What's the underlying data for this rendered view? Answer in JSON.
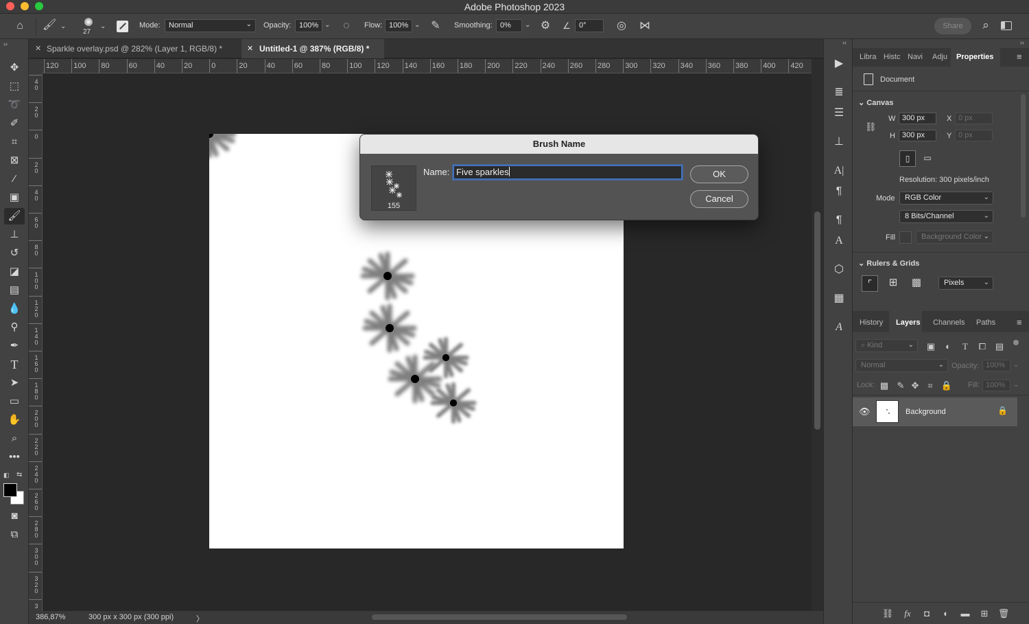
{
  "window": {
    "title": "Adobe Photoshop 2023"
  },
  "options_bar": {
    "brush_size": "27",
    "mode_label": "Mode:",
    "mode_value": "Normal",
    "opacity_label": "Opacity:",
    "opacity_value": "100%",
    "flow_label": "Flow:",
    "flow_value": "100%",
    "smoothing_label": "Smoothing:",
    "smoothing_value": "0%",
    "angle_value": "0°",
    "share_label": "Share"
  },
  "tabs": [
    {
      "label": "Sparkle overlay.psd @ 282% (Layer 1, RGB/8) *",
      "active": false
    },
    {
      "label": "Untitled-1 @ 387% (RGB/8) *",
      "active": true
    }
  ],
  "ruler_h_labels": [
    "120",
    "100",
    "80",
    "60",
    "40",
    "20",
    "0",
    "20",
    "40",
    "60",
    "80",
    "100",
    "120",
    "140",
    "160",
    "180",
    "200",
    "220",
    "240",
    "260",
    "280",
    "300",
    "320",
    "340",
    "360",
    "380",
    "400",
    "420"
  ],
  "ruler_v_labels": [
    "40",
    "20",
    "0",
    "20",
    "40",
    "60",
    "80",
    "100",
    "120",
    "140",
    "160",
    "180",
    "200",
    "220",
    "240",
    "260",
    "280",
    "300",
    "320",
    "3"
  ],
  "status": {
    "zoom": "386,87%",
    "doc_info": "300 px x 300 px (300 ppi)",
    "arrow": "〉"
  },
  "dialog": {
    "title": "Brush Name",
    "preview_size": "155",
    "name_label": "Name:",
    "name_value": "Five sparkles",
    "ok_label": "OK",
    "cancel_label": "Cancel"
  },
  "properties_panel": {
    "tabs": [
      "Libra",
      "Histc",
      "Navi",
      "Adju",
      "Properties"
    ],
    "document_label": "Document",
    "canvas_section": "Canvas",
    "w_label": "W",
    "w_value": "300 px",
    "h_label": "H",
    "h_value": "300 px",
    "x_label": "X",
    "x_value": "0 px",
    "y_label": "Y",
    "y_value": "0 px",
    "resolution": "Resolution: 300 pixels/inch",
    "mode_label": "Mode",
    "mode_value": "RGB Color",
    "bits_value": "8 Bits/Channel",
    "fill_label": "Fill",
    "fill_value": "Background Color",
    "rulers_section": "Rulers & Grids",
    "units_value": "Pixels"
  },
  "layers_panel": {
    "tabs": [
      "History",
      "Layers",
      "Channels",
      "Paths"
    ],
    "kind_placeholder": "Kind",
    "blend_mode": "Normal",
    "opacity_label": "Opacity:",
    "opacity_value": "100%",
    "lock_label": "Lock:",
    "fill_label": "Fill:",
    "fill_value": "100%",
    "layers": [
      {
        "name": "Background",
        "visible": true,
        "locked": true
      }
    ]
  },
  "colors": {
    "accent_focus": "#3d7bd9",
    "bg": "#282828",
    "panel": "#424242"
  }
}
